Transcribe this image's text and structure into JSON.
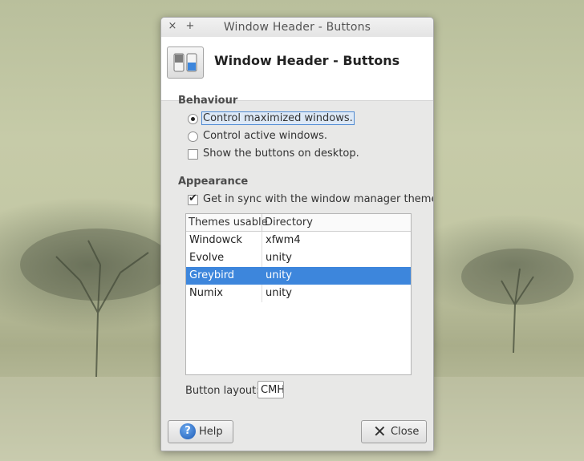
{
  "titlebar": {
    "title": "Window Header - Buttons",
    "close_glyph": "×",
    "pin_glyph": "+"
  },
  "header": {
    "title": "Window Header - Buttons",
    "icon": "toggle-switches-icon"
  },
  "behaviour": {
    "section_label": "Behaviour",
    "options": [
      {
        "label": "Control maximized windows.",
        "type": "radio",
        "checked": true
      },
      {
        "label": "Control active windows.",
        "type": "radio",
        "checked": false
      },
      {
        "label": "Show the buttons on desktop.",
        "type": "checkbox",
        "checked": false
      }
    ]
  },
  "appearance": {
    "section_label": "Appearance",
    "sync_label": "Get in sync with the window manager theme.",
    "sync_checked": true,
    "tick_glyph": "✔",
    "columns": [
      "Themes usable",
      "Directory"
    ],
    "rows": [
      {
        "theme": "Windowck",
        "directory": "xfwm4",
        "selected": false
      },
      {
        "theme": "Evolve",
        "directory": "unity",
        "selected": false
      },
      {
        "theme": "Greybird",
        "directory": "unity",
        "selected": true
      },
      {
        "theme": "Numix",
        "directory": "unity",
        "selected": false
      }
    ]
  },
  "button_layout": {
    "label": "Button layout:",
    "value": "CMH"
  },
  "footer": {
    "help_label": "Help",
    "help_glyph": "?",
    "close_label": "Close",
    "close_glyph": "✕"
  },
  "colors": {
    "selection": "#3d86dc",
    "focus_outline": "#4f8ad2"
  }
}
